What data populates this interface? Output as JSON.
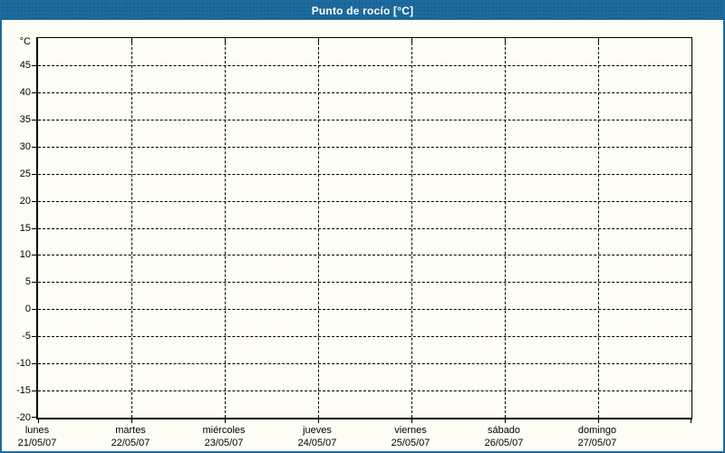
{
  "window": {
    "title": "Punto de rocío [°C]"
  },
  "colors": {
    "frame_blue": "#1d6b9e",
    "title_text": "#ffffff",
    "background": "#fdfdf5",
    "axis_and_grid": "#000000",
    "label_text": "#000000"
  },
  "chart_data": {
    "type": "line",
    "title": "Punto de rocío [°C]",
    "y_axis": {
      "unit_label": "°C",
      "ticks": [
        45,
        40,
        35,
        30,
        25,
        20,
        15,
        10,
        5,
        0,
        -5,
        -10,
        -15,
        -20
      ],
      "range": [
        -20,
        50
      ]
    },
    "x_axis": {
      "divisions": 7,
      "categories": [
        {
          "day": "lunes",
          "date": "21/05/07"
        },
        {
          "day": "martes",
          "date": "22/05/07"
        },
        {
          "day": "miércoles",
          "date": "23/05/07"
        },
        {
          "day": "jueves",
          "date": "24/05/07"
        },
        {
          "day": "viernes",
          "date": "25/05/07"
        },
        {
          "day": "sábado",
          "date": "26/05/07"
        },
        {
          "day": "domingo",
          "date": "27/05/07"
        }
      ]
    },
    "grid": {
      "style": "dashed",
      "horizontal": true,
      "vertical": true
    },
    "legend": "none",
    "series": [],
    "note": "empty plot - no data series drawn"
  }
}
